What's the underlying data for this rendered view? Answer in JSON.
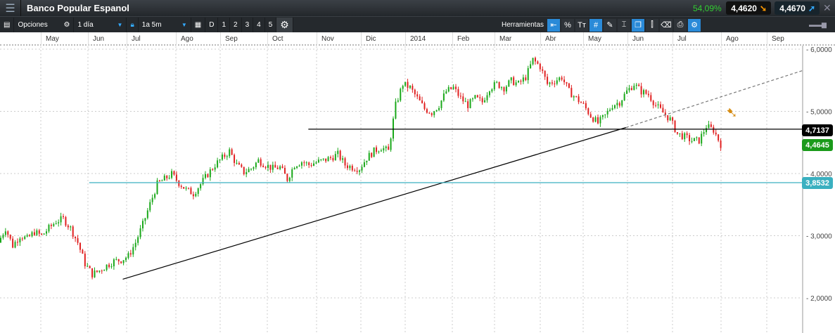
{
  "title": "Banco Popular Espanol",
  "change_pct": "54,09%",
  "sell_price": "4,4620",
  "buy_price": "4,4670",
  "toolbar": {
    "options_label": "Opciones",
    "interval": "1 día",
    "range": "1a 5m",
    "day_buttons": [
      "D",
      "1",
      "2",
      "3",
      "4",
      "5"
    ],
    "tools_label": "Herramientas"
  },
  "months": [
    "May",
    "Jun",
    "Jul",
    "Ago",
    "Sep",
    "Oct",
    "Nov",
    "Dic",
    "2014",
    "Feb",
    "Mar",
    "Abr",
    "May",
    "Jun",
    "Jul",
    "Ago",
    "Sep"
  ],
  "price_labels": {
    "resistance": "4,7137",
    "last": "4,4645",
    "support": "3,8532"
  },
  "colors": {
    "up": "#1aa81a",
    "down": "#e02020",
    "support": "#3ab0c0",
    "last": "#1a9a1a"
  },
  "chart_data": {
    "type": "candlestick",
    "title": "Banco Popular Espanol",
    "y_ticks": [
      "6,0000",
      "5,0000",
      "4,0000",
      "3,0000",
      "2,0000"
    ],
    "ylim": [
      1.55,
      6.1
    ],
    "period": "Abr 2013 - Jul 2014, 1 día",
    "closes": [
      2.89,
      3.12,
      2.84,
      3.0,
      2.95,
      3.06,
      3.0,
      3.12,
      3.23,
      3.27,
      3.12,
      2.89,
      2.55,
      2.38,
      2.44,
      2.52,
      2.59,
      2.61,
      2.67,
      2.89,
      3.18,
      3.51,
      3.83,
      3.91,
      3.99,
      3.85,
      3.74,
      3.68,
      3.83,
      3.99,
      4.14,
      4.25,
      4.36,
      4.14,
      4.02,
      4.08,
      4.21,
      4.14,
      4.08,
      4.1,
      3.91,
      4.14,
      4.19,
      4.14,
      4.18,
      4.21,
      4.25,
      4.31,
      4.14,
      4.1,
      4.08,
      4.25,
      4.36,
      4.42,
      4.36,
      5.1,
      5.44,
      5.38,
      5.21,
      5.04,
      4.98,
      5.1,
      5.32,
      5.38,
      5.21,
      5.1,
      5.21,
      5.15,
      5.38,
      5.44,
      5.38,
      5.49,
      5.44,
      5.55,
      5.83,
      5.72,
      5.44,
      5.49,
      5.55,
      5.32,
      5.21,
      5.1,
      4.93,
      4.81,
      4.93,
      5.1,
      5.15,
      5.32,
      5.44,
      5.32,
      5.27,
      5.1,
      4.98,
      4.87,
      4.64,
      4.59,
      4.53,
      4.53,
      4.76,
      4.7,
      4.47
    ],
    "lines": [
      {
        "name": "trendline",
        "style": "solid",
        "from": {
          "date": "2013-06-28",
          "price": 2.3
        },
        "to": {
          "date": "2014-05-30",
          "price": 4.74
        }
      },
      {
        "name": "trendline-extension",
        "style": "dashed",
        "from": {
          "date": "2014-05-30",
          "price": 4.74
        },
        "to": {
          "date": "2014-09-25",
          "price": 5.66
        }
      },
      {
        "name": "resistance",
        "style": "solid",
        "price": 4.7137,
        "from_date": "2013-10-26"
      },
      {
        "name": "support",
        "style": "solid",
        "price": 3.8532,
        "from_date": "2013-06-02"
      }
    ]
  }
}
